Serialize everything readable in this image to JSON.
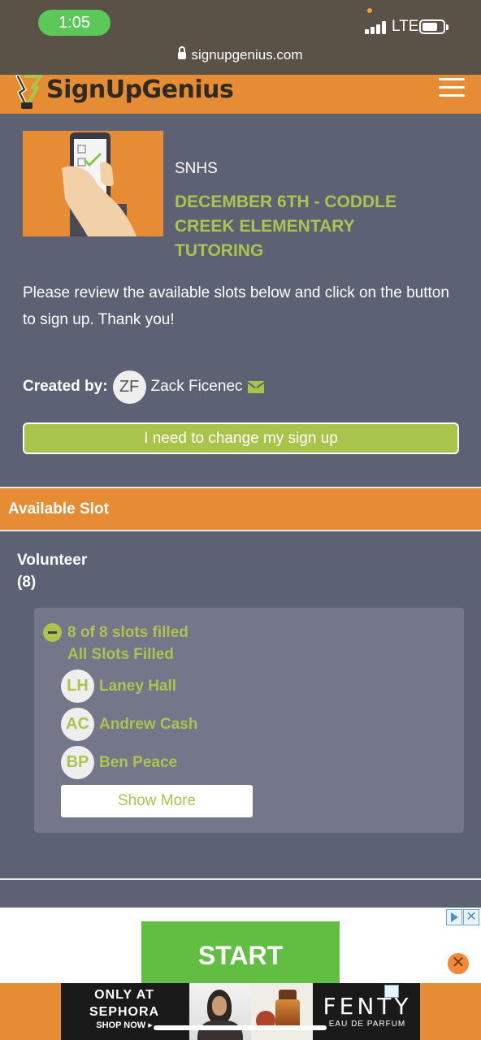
{
  "status_bar": {
    "time": "1:05",
    "network": "LTE",
    "url": "signupgenius.com"
  },
  "header": {
    "logo_text": "SignUpGenius",
    "colors": {
      "accent": "#e58c34",
      "green": "#adc34e",
      "background": "#5c6174"
    }
  },
  "signup": {
    "organization": "SNHS",
    "title": "DECEMBER 6TH - CODDLE CREEK ELEMENTARY TUTORING",
    "description": "Please review the available slots below and click on the button to sign up. Thank you!",
    "created_by_label": "Created by:",
    "creator_initials": "ZF",
    "creator_name": "Zack Ficenec",
    "change_button": "I need to change my sign up"
  },
  "slots": {
    "header": "Available Slot",
    "role": "Volunteer",
    "role_count": "(8)",
    "filled_text": "8 of 8 slots filled",
    "all_filled_text": "All Slots Filled",
    "people": [
      {
        "initials": "LH",
        "name": "Laney Hall"
      },
      {
        "initials": "AC",
        "name": "Andrew Cash"
      },
      {
        "initials": "BP",
        "name": "Ben Peace"
      }
    ],
    "show_more": "Show More"
  },
  "ad": {
    "start_label": "START",
    "close_glyph": "✕",
    "x_glyph": "✕",
    "banner": {
      "line1": "ONLY AT",
      "line2": "SEPHORA",
      "shop_now": "SHOP NOW ▸",
      "brand": "FENTY",
      "brand_sub": "EAU DE PARFUM"
    }
  }
}
